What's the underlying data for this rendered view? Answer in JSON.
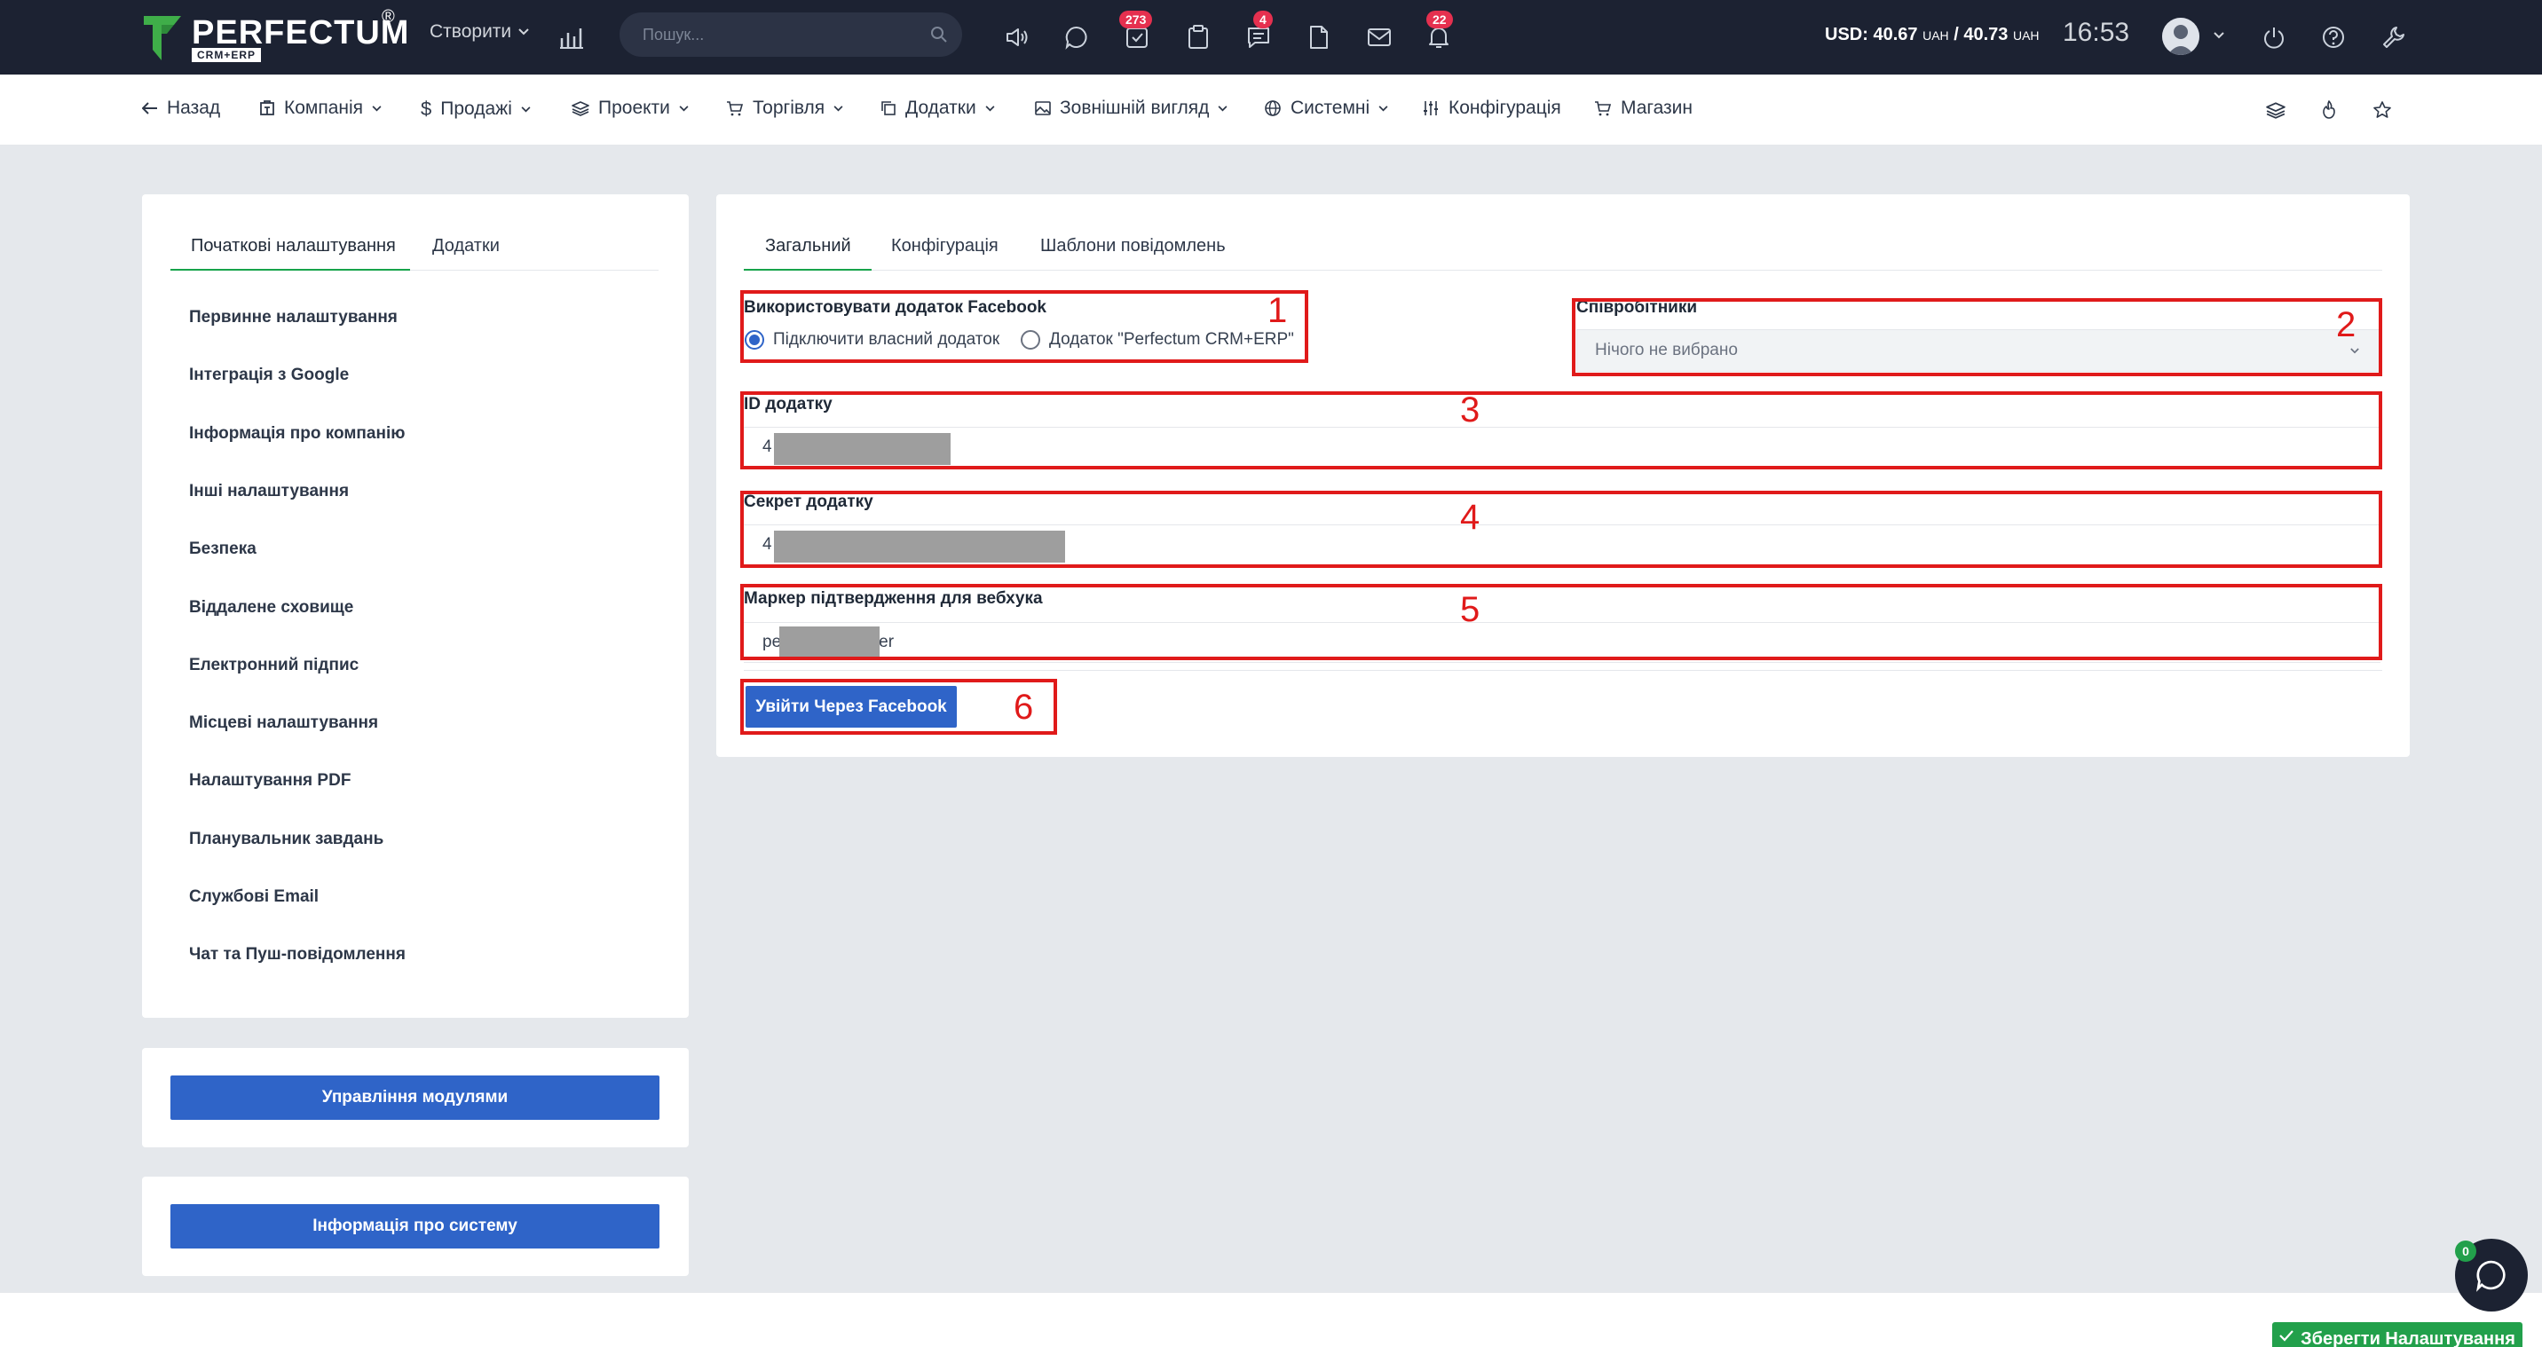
{
  "header": {
    "logo_text": "PERFECTUM",
    "logo_sub": "CRM+ERP",
    "logo_reg": "®",
    "create_label": "Створити",
    "search_placeholder": "Пошук...",
    "badges": {
      "tasks": "273",
      "messages": "4",
      "notifications": "22"
    },
    "currency_label": "USD:",
    "currency_buy": "40.67",
    "currency_sell": "40.73",
    "currency_unit": "UAH",
    "currency_sep": "/",
    "time": "16:53",
    "icons": [
      "chart-icon",
      "megaphone-icon",
      "chat-icon",
      "tasks-icon",
      "clipboard-icon",
      "messages-icon",
      "file-icon",
      "mail-icon",
      "bell-icon",
      "power-icon",
      "help-icon",
      "wrench-icon"
    ]
  },
  "nav": {
    "back": "Назад",
    "company": "Компанія",
    "sales": "Продажі",
    "projects": "Проекти",
    "trade": "Торгівля",
    "addons": "Додатки",
    "appearance": "Зовнішній вигляд",
    "system": "Системні",
    "config": "Конфігурація",
    "shop": "Магазин"
  },
  "sidebar": {
    "tabs": [
      "Початкові налаштування",
      "Додатки"
    ],
    "items": [
      "Первинне налаштування",
      "Інтеграція з Google",
      "Інформація про компанію",
      "Інші налаштування",
      "Безпека",
      "Віддалене сховище",
      "Електронний підпис",
      "Місцеві налаштування",
      "Налаштування PDF",
      "Планувальник завдань",
      "Службові Email",
      "Чат та Пуш-повідомлення"
    ],
    "modules_button": "Управління модулями",
    "system_info_button": "Інформація про систему"
  },
  "main": {
    "tabs": [
      "Загальний",
      "Конфігурація",
      "Шаблони повідомлень"
    ],
    "use_app_label": "Використовувати додаток Facebook",
    "radio_own": "Підключити власний додаток",
    "radio_perfectum": "Додаток \"Perfectum CRM+ERP\"",
    "radio_own_selected": true,
    "employees_label": "Співробітники",
    "employees_value": "Нічого не вибрано",
    "app_id_label": "ID додатку",
    "app_id_value": "4",
    "app_secret_label": "Секрет додатку",
    "app_secret_value": "4",
    "webhook_label": "Маркер підтвердження для вебхука",
    "webhook_prefix": "pe",
    "webhook_suffix": "er",
    "login_button": "Увійти Через Facebook"
  },
  "annotations": [
    "1",
    "2",
    "3",
    "4",
    "5",
    "6"
  ],
  "footer": {
    "save_button": "Зберегти Налаштування",
    "chat_badge": "0"
  },
  "colors": {
    "topbar": "#1c2232",
    "accent_blue": "#2f64c8",
    "accent_green": "#22a04b",
    "annotation_red": "#e01a1a",
    "badge_red": "#e5304f"
  }
}
